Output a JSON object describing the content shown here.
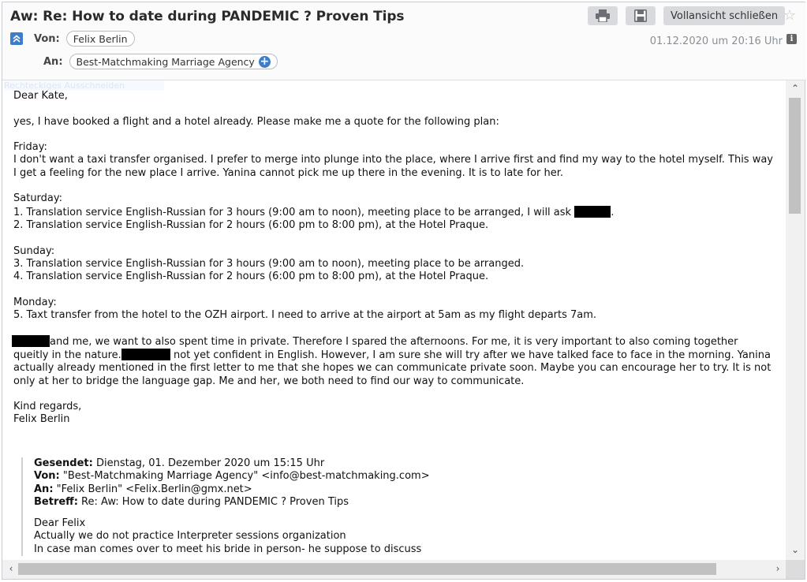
{
  "header": {
    "subject": "Aw: Re: How to date during PANDEMIC ? Proven Tips",
    "print_icon": "printer-icon",
    "save_icon": "floppy-disk-icon",
    "close_fullview_label": "Vollansicht schließen",
    "star_icon": "star-outline-icon",
    "from_label": "Von:",
    "from_value": "Felix Berlin",
    "to_label": "An:",
    "to_value": "Best-Matchmaking Marriage Agency",
    "date": "01.12.2020 um 20:16 Uhr",
    "info_icon": "info-icon",
    "accent": "#3d7cc9"
  },
  "body": {
    "ghost_text": "Rechteckiges Ausschneiden",
    "greeting": "Dear Kate,",
    "intro": "yes, I have booked a flight and a hotel already. Please make me a quote for the following plan:",
    "friday_head": "Friday:",
    "friday_text": "I don't want a taxi transfer organised. I prefer to merge into plunge into the place, where I arrive first and find my way to the hotel myself. This way I get a feeling for the new place I arrive. Yanina cannot pick me up there in the evening. It is to late for her.",
    "saturday_head": "Saturday:",
    "sat_1": "1. Translation service English-Russian for 3 hours (9:00 am to noon), meeting place to be arranged, I will ask",
    "sat_1_end": ".",
    "sat_2": "2. Translation service English-Russian for 2 hours (6:00 pm to 8:00 pm), at the Hotel Praque.",
    "sunday_head": "Sunday:",
    "sun_3": "3. Translation service English-Russian for 3 hours (9:00 am to noon), meeting place to be arranged.",
    "sun_4": "4. Translation service English-Russian for 2 hours (6:00 pm to 8:00 pm), at the Hotel Praque.",
    "monday_head": "Monday:",
    "mon_5": "5. Taxt transfer from the hotel to the OZH airport. I need to arrive at the airport at 5am as my flight departs 7am.",
    "para_a": "and me, we want to also spent time in private. Therefore I spared the afternoons. For me, it is very important to also coming together",
    "para_b": "queitly in the nature.",
    "para_c": " not yet confident in English. However, I am sure she will try after we have talked face to face in the morning.",
    "para_d": "Yanina actually already mentioned in the first letter to me that she hopes we can communicate private soon. Maybe you can encourage her to try. It is not only at her to bridge the language gap. Me and her, we both need to find our way to communicate.",
    "regards": "Kind regards,",
    "signature": "Felix Berlin"
  },
  "quote": {
    "sent_label": "Gesendet:",
    "sent_value": " Dienstag, 01. Dezember 2020 um 15:15 Uhr",
    "from_label": "Von:",
    "from_value": " \"Best-Matchmaking Marriage Agency\" <info@best-matchmaking.com>",
    "to_label": "An:",
    "to_value": " \"Felix Berlin\" <Felix.Berlin@gmx.net>",
    "subject_label": "Betreff:",
    "subject_value": " Re: Aw: How to date during PANDEMIC ? Proven Tips",
    "line1": "Dear Felix",
    "line2": "Actually we do not practice Interpreter sessions organization",
    "line3": "In case man comes over to meet his bride in person- he suppose to discuss"
  }
}
